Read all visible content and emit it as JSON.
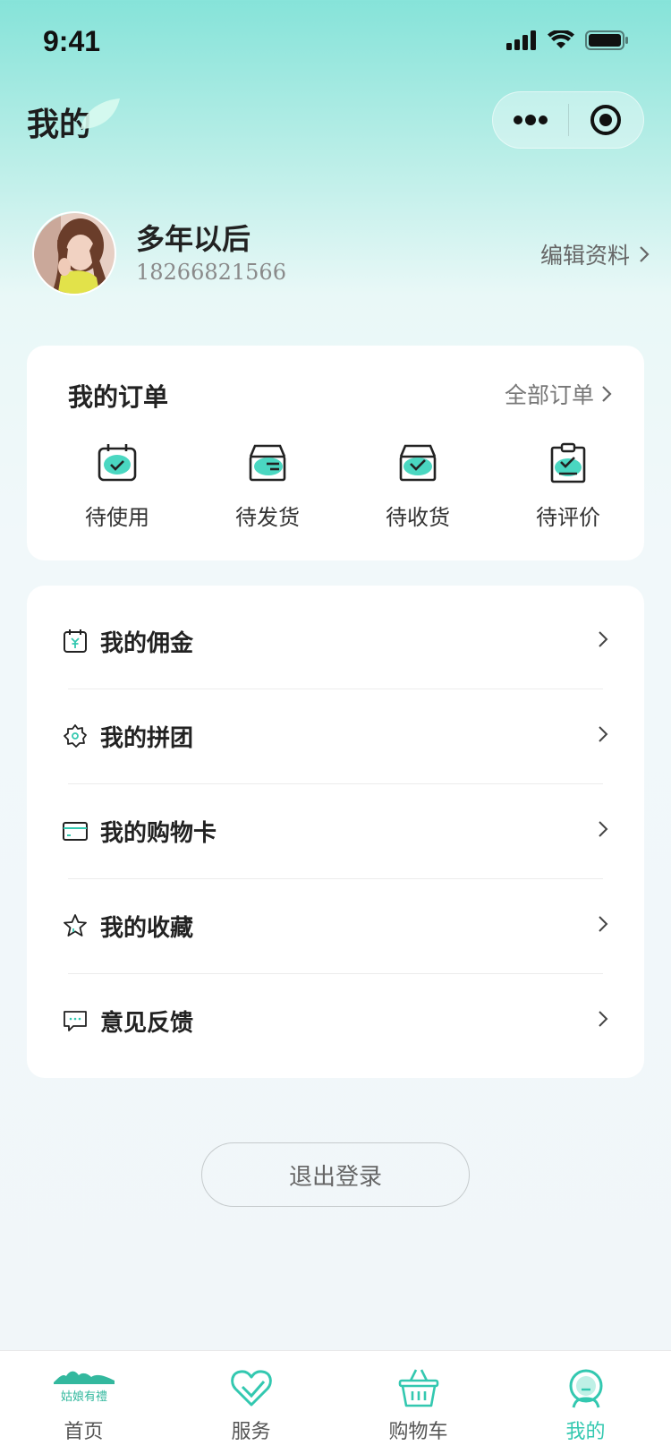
{
  "status_bar": {
    "time": "9:41"
  },
  "nav": {
    "title": "我的"
  },
  "profile": {
    "name": "多年以后",
    "phone": "18266821566",
    "edit_label": "编辑资料"
  },
  "orders": {
    "title": "我的订单",
    "all_label": "全部订单",
    "items": [
      {
        "label": "待使用",
        "icon": "calendar-check-icon"
      },
      {
        "label": "待发货",
        "icon": "box-icon"
      },
      {
        "label": "待收货",
        "icon": "box-check-icon"
      },
      {
        "label": "待评价",
        "icon": "clipboard-check-icon"
      }
    ]
  },
  "menu": {
    "items": [
      {
        "label": "我的佣金",
        "icon": "yen-calendar-icon"
      },
      {
        "label": "我的拼团",
        "icon": "gear-group-icon"
      },
      {
        "label": "我的购物卡",
        "icon": "card-icon"
      },
      {
        "label": "我的收藏",
        "icon": "star-icon"
      },
      {
        "label": "意见反馈",
        "icon": "message-icon"
      }
    ]
  },
  "logout_label": "退出登录",
  "tabbar": {
    "items": [
      {
        "label": "首页",
        "icon": "home-logo-icon",
        "logo_text": "姑娘有禮"
      },
      {
        "label": "服务",
        "icon": "heart-icon"
      },
      {
        "label": "购物车",
        "icon": "basket-icon"
      },
      {
        "label": "我的",
        "icon": "profile-icon",
        "active": true
      }
    ]
  },
  "colors": {
    "accent": "#33c8b0",
    "accent_light": "#5fd8c6"
  }
}
